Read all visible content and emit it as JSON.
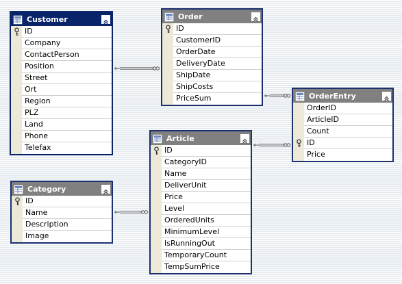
{
  "tables": [
    {
      "id": "customer",
      "name": "Customer",
      "selected": true,
      "fields": [
        {
          "name": "ID",
          "key": true
        },
        {
          "name": "Company"
        },
        {
          "name": "ContactPerson"
        },
        {
          "name": "Position"
        },
        {
          "name": "Street"
        },
        {
          "name": "Ort"
        },
        {
          "name": "Region"
        },
        {
          "name": "PLZ"
        },
        {
          "name": "Land"
        },
        {
          "name": "Phone"
        },
        {
          "name": "Telefax"
        }
      ]
    },
    {
      "id": "order",
      "name": "Order",
      "selected": false,
      "fields": [
        {
          "name": "ID",
          "key": true
        },
        {
          "name": "CustomerID"
        },
        {
          "name": "OrderDate"
        },
        {
          "name": "DeliveryDate"
        },
        {
          "name": "ShipDate"
        },
        {
          "name": "ShipCosts"
        },
        {
          "name": "PriceSum"
        }
      ]
    },
    {
      "id": "orderentry",
      "name": "OrderEntry",
      "selected": false,
      "fields": [
        {
          "name": "OrderID"
        },
        {
          "name": "ArticleID"
        },
        {
          "name": "Count"
        },
        {
          "name": "ID",
          "key": true
        },
        {
          "name": "Price"
        }
      ]
    },
    {
      "id": "article",
      "name": "Article",
      "selected": false,
      "fields": [
        {
          "name": "ID",
          "key": true
        },
        {
          "name": "CategoryID"
        },
        {
          "name": "Name"
        },
        {
          "name": "DeliverUnit"
        },
        {
          "name": "Price"
        },
        {
          "name": "Level"
        },
        {
          "name": "OrderedUnits"
        },
        {
          "name": "MinimumLevel"
        },
        {
          "name": "IsRunningOut"
        },
        {
          "name": "TemporaryCount"
        },
        {
          "name": "TempSumPrice"
        }
      ]
    },
    {
      "id": "category",
      "name": "Category",
      "selected": false,
      "fields": [
        {
          "name": "ID",
          "key": true
        },
        {
          "name": "Name"
        },
        {
          "name": "Description"
        },
        {
          "name": "Image"
        }
      ]
    }
  ],
  "relationships": [
    {
      "name": "customer-order",
      "from": "customer",
      "to": "order"
    },
    {
      "name": "order-orderentry",
      "from": "order",
      "to": "orderentry"
    },
    {
      "name": "article-orderentry",
      "from": "article",
      "to": "orderentry"
    },
    {
      "name": "category-article",
      "from": "category",
      "to": "article"
    }
  ],
  "colors": {
    "selected_title": "#0a246a",
    "unselected_title": "#808080",
    "table_border": "#0a246a",
    "key_column": "#ece9d8",
    "connector": "#555555"
  },
  "icons": {
    "table": "table-icon",
    "key": "key-icon",
    "collapse": "collapse-up-icon"
  }
}
